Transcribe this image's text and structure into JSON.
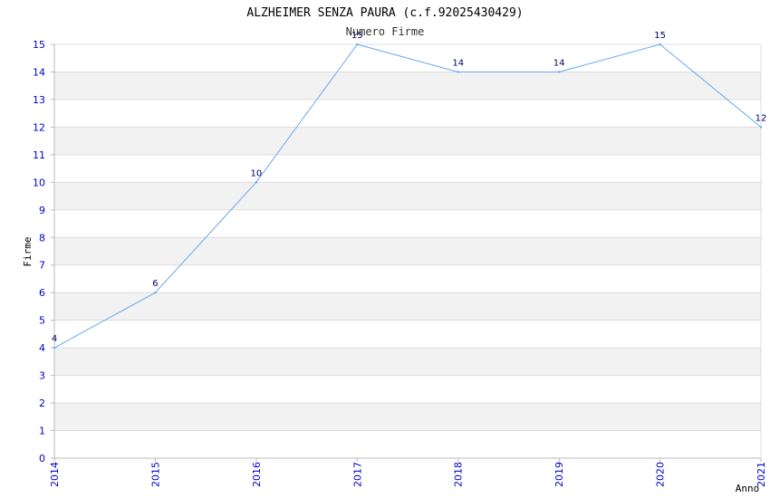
{
  "colors": {
    "band_light": "#ffffff",
    "band_dark": "#f2f2f2",
    "grid": "#dddddd",
    "axis": "#bbbbbb",
    "line": "#66aaee",
    "tick_text": "#0000cc"
  },
  "chart_data": {
    "type": "line",
    "title": "ALZHEIMER SENZA PAURA (c.f.92025430429)",
    "subtitle": "Numero Firme",
    "xlabel": "Anno",
    "ylabel": "Firme",
    "x": [
      2014,
      2015,
      2016,
      2017,
      2018,
      2019,
      2020,
      2021
    ],
    "x_tick_labels": [
      "2014",
      "2015",
      "2016",
      "2017",
      "2018",
      "2019",
      "2020",
      "2021"
    ],
    "series": [
      {
        "values": [
          4,
          6,
          10,
          15,
          14,
          14,
          15,
          12
        ],
        "data_labels": [
          "4",
          "6",
          "10",
          "15",
          "14",
          "14",
          "15",
          "12"
        ]
      }
    ],
    "ylim": [
      0,
      15
    ],
    "y_ticks": [
      "0",
      "1",
      "2",
      "3",
      "4",
      "5",
      "6",
      "7",
      "8",
      "9",
      "10",
      "11",
      "12",
      "13",
      "14",
      "15"
    ],
    "grid": true,
    "banded_background": true,
    "legend": "none"
  }
}
